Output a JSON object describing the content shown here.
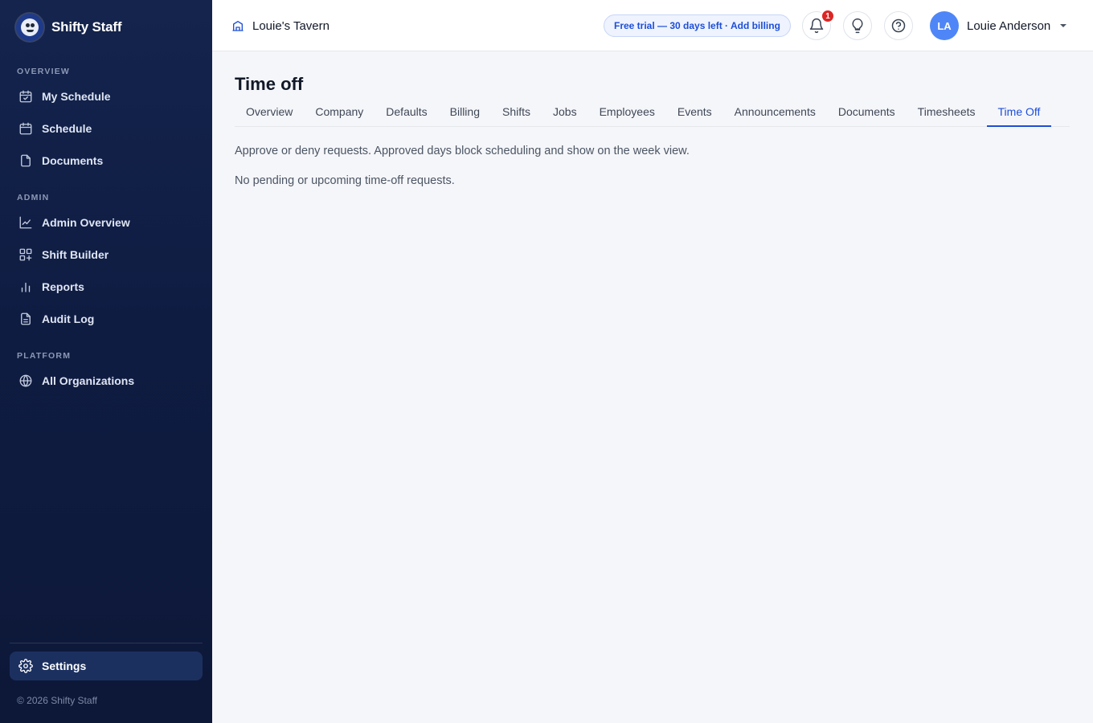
{
  "brand": {
    "name": "Shifty Staff"
  },
  "sidebar": {
    "sections": [
      {
        "label": "OVERVIEW"
      },
      {
        "label": "ADMIN"
      },
      {
        "label": "PLATFORM"
      }
    ],
    "items": [
      {
        "label": "My Schedule",
        "icon": "calendar-check-icon"
      },
      {
        "label": "Schedule",
        "icon": "calendar-icon"
      },
      {
        "label": "Documents",
        "icon": "file-icon"
      },
      {
        "label": "Admin Overview",
        "icon": "line-chart-icon"
      },
      {
        "label": "Shift Builder",
        "icon": "grid-plus-icon"
      },
      {
        "label": "Reports",
        "icon": "bar-chart-icon"
      },
      {
        "label": "Audit Log",
        "icon": "file-text-icon"
      },
      {
        "label": "All Organizations",
        "icon": "globe-icon"
      }
    ],
    "settings_label": "Settings",
    "copyright": "© 2026 Shifty Staff"
  },
  "header": {
    "org_name": "Louie's Tavern",
    "trial_text": "Free trial — 30 days left · Add billing",
    "notification_count": "1",
    "user": {
      "initials": "LA",
      "name": "Louie Anderson"
    }
  },
  "main": {
    "title": "Time off",
    "tabs": [
      {
        "label": "Overview"
      },
      {
        "label": "Company"
      },
      {
        "label": "Defaults"
      },
      {
        "label": "Billing"
      },
      {
        "label": "Shifts"
      },
      {
        "label": "Jobs"
      },
      {
        "label": "Employees"
      },
      {
        "label": "Events"
      },
      {
        "label": "Announcements"
      },
      {
        "label": "Documents"
      },
      {
        "label": "Timesheets"
      },
      {
        "label": "Time Off"
      }
    ],
    "active_tab": "Time Off",
    "description": "Approve or deny requests. Approved days block scheduling and show on the week view.",
    "empty_text": "No pending or upcoming time-off requests."
  },
  "colors": {
    "sidebar_bg": "#0f1c42",
    "accent": "#1d4ed8",
    "badge": "#dc2626",
    "avatar": "#4f86f7"
  }
}
